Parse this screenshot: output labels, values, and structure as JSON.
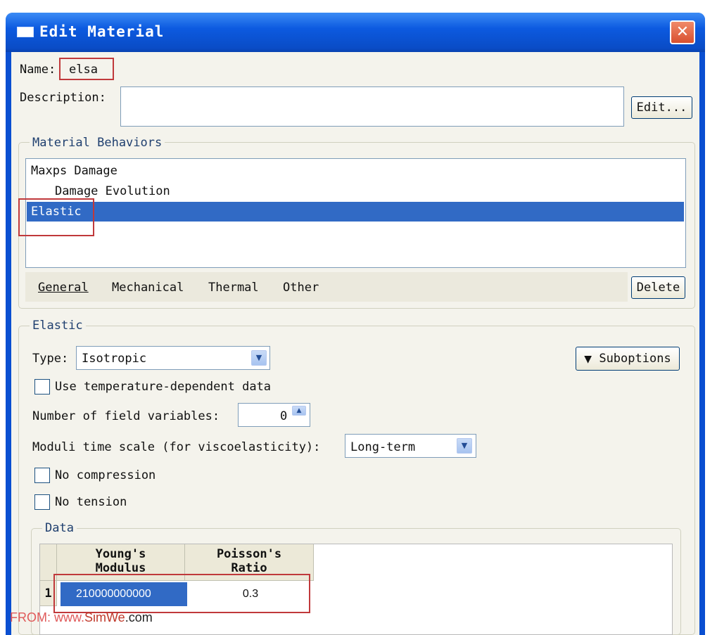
{
  "window": {
    "title": "Edit Material",
    "close_glyph": "✕"
  },
  "name_field": {
    "label": "Name:",
    "value": "elsa"
  },
  "description": {
    "label": "Description:",
    "value": "",
    "edit_button": "Edit..."
  },
  "material_behaviors": {
    "title": "Material Behaviors",
    "items": [
      {
        "label": "Maxps Damage",
        "indent": 0,
        "selected": false
      },
      {
        "label": "Damage Evolution",
        "indent": 1,
        "selected": false
      },
      {
        "label": "Elastic",
        "indent": 0,
        "selected": true
      }
    ],
    "menus": [
      "General",
      "Mechanical",
      "Thermal",
      "Other"
    ],
    "delete_button": "Delete"
  },
  "elastic": {
    "title": "Elastic",
    "type_label": "Type:",
    "type_value": "Isotropic",
    "suboptions_button": "Suboptions",
    "suboptions_glyph": "▼",
    "use_temp_label": "Use temperature-dependent data",
    "use_temp_checked": false,
    "field_vars_label": "Number of field variables:",
    "field_vars_value": "0",
    "moduli_label": "Moduli time scale (for viscoelasticity):",
    "moduli_value": "Long-term",
    "no_compression_label": "No compression",
    "no_compression_checked": false,
    "no_tension_label": "No tension",
    "no_tension_checked": false
  },
  "data_table": {
    "title": "Data",
    "headers": [
      {
        "line1": "Young's",
        "line2": "Modulus"
      },
      {
        "line1": "Poisson's",
        "line2": "Ratio"
      }
    ],
    "rows": [
      {
        "index": "1",
        "values": [
          "210000000000",
          "0.3"
        ]
      }
    ]
  },
  "watermark": {
    "prefix": "FROM: www.",
    "brand": "SimWe",
    "suffix": ".com"
  },
  "colors": {
    "titlebar": "#0a4fd1",
    "selection": "#316ac5",
    "highlight_box": "#c0393b",
    "dialog_bg": "#f4f3ec"
  },
  "icons": {
    "close": "close-icon",
    "combo": "chevron-down-icon",
    "spinner": "spinner-up-icon",
    "suboptions": "triangle-down-icon"
  }
}
